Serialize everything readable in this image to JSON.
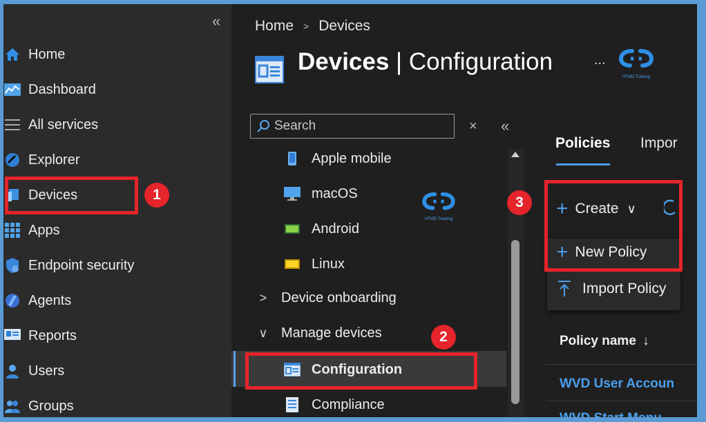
{
  "leftnav": {
    "collapse_glyph": "«",
    "items": [
      {
        "label": "Home",
        "icon": "home-icon"
      },
      {
        "label": "Dashboard",
        "icon": "dashboard-icon"
      },
      {
        "label": "All services",
        "icon": "list-icon"
      },
      {
        "label": "Explorer",
        "icon": "explorer-icon"
      },
      {
        "label": "Devices",
        "icon": "devices-icon"
      },
      {
        "label": "Apps",
        "icon": "apps-grid-icon"
      },
      {
        "label": "Endpoint security",
        "icon": "shield-icon"
      },
      {
        "label": "Agents",
        "icon": "agents-icon"
      },
      {
        "label": "Reports",
        "icon": "reports-icon"
      },
      {
        "label": "Users",
        "icon": "user-icon"
      },
      {
        "label": "Groups",
        "icon": "groups-icon"
      }
    ]
  },
  "breadcrumb": {
    "home": "Home",
    "sep": ">",
    "current": "Devices"
  },
  "page": {
    "title_bold": "Devices",
    "title_rest": " | Configuration",
    "more": "..."
  },
  "watermark": {
    "text": "HTMD Training"
  },
  "blade": {
    "search_placeholder": "Search",
    "clear_glyph": "×",
    "collapse_glyph": "«",
    "items": [
      {
        "label": "Apple mobile"
      },
      {
        "label": "macOS"
      },
      {
        "label": "Android"
      },
      {
        "label": "Linux"
      },
      {
        "label": "Device onboarding",
        "chevron": ">"
      },
      {
        "label": "Manage devices",
        "chevron": "∨"
      },
      {
        "label": "Configuration"
      },
      {
        "label": "Compliance"
      }
    ]
  },
  "tabs": [
    {
      "label": "Policies"
    },
    {
      "label": "Impor"
    }
  ],
  "toolbar": {
    "create": "Create",
    "create_chevron": "∨"
  },
  "menu": {
    "new_policy": "New Policy",
    "import_policy": "Import Policy"
  },
  "table": {
    "col_policy_name": "Policy name",
    "sort_glyph": "↓",
    "rows": [
      "WVD User Accoun",
      "WVD Start Menu"
    ]
  },
  "annotations": {
    "n1": "1",
    "n2": "2",
    "n3": "3"
  },
  "colors": {
    "accent": "#4a9de8",
    "annotation_red": "#e5242b",
    "link": "#4aa0ee"
  }
}
